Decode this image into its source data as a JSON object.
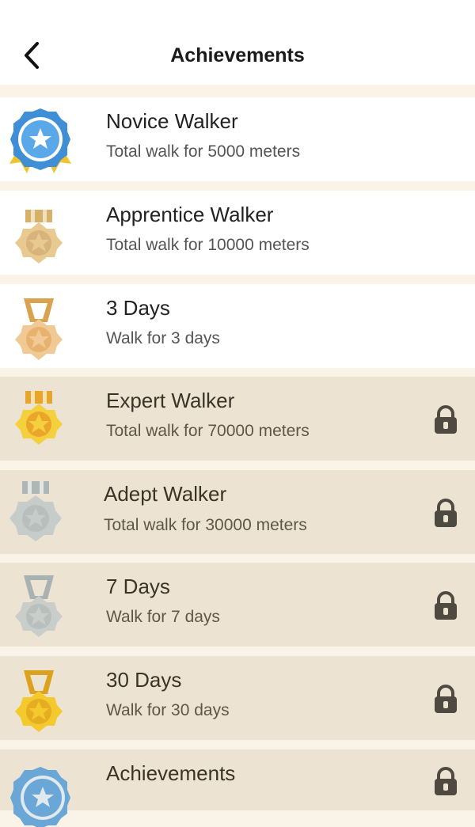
{
  "header": {
    "title": "Achievements",
    "back_icon": "chevron-left-icon"
  },
  "achievements": [
    {
      "name": "Novice Walker",
      "desc": "Total walk for 5000 meters",
      "locked": false,
      "medal": "blue-rosette-medal-icon"
    },
    {
      "name": "Apprentice Walker",
      "desc": "Total walk for 10000 meters",
      "locked": false,
      "medal": "bronze-star-medal-icon"
    },
    {
      "name": "3 Days",
      "desc": "Walk for 3 days",
      "locked": false,
      "medal": "bronze-ribbon-medal-icon"
    },
    {
      "name": "Expert Walker",
      "desc": "Total walk for 70000 meters",
      "locked": true,
      "medal": "gold-star-medal-icon"
    },
    {
      "name": "Adept Walker",
      "desc": "Total walk for 30000 meters",
      "locked": true,
      "medal": "silver-star-medal-icon"
    },
    {
      "name": "7 Days",
      "desc": "Walk for 7 days",
      "locked": true,
      "medal": "silver-ribbon-medal-icon"
    },
    {
      "name": "30 Days",
      "desc": "Walk for 30 days",
      "locked": true,
      "medal": "gold-ribbon-medal-icon"
    },
    {
      "name": "Achievements",
      "desc": "",
      "locked": true,
      "medal": "blue-star-medal-icon"
    }
  ],
  "colors": {
    "background": "#faf4e8",
    "locked_row": "#ede3d2",
    "unlocked_row": "#ffffff",
    "lock_icon": "#4e4a42"
  }
}
